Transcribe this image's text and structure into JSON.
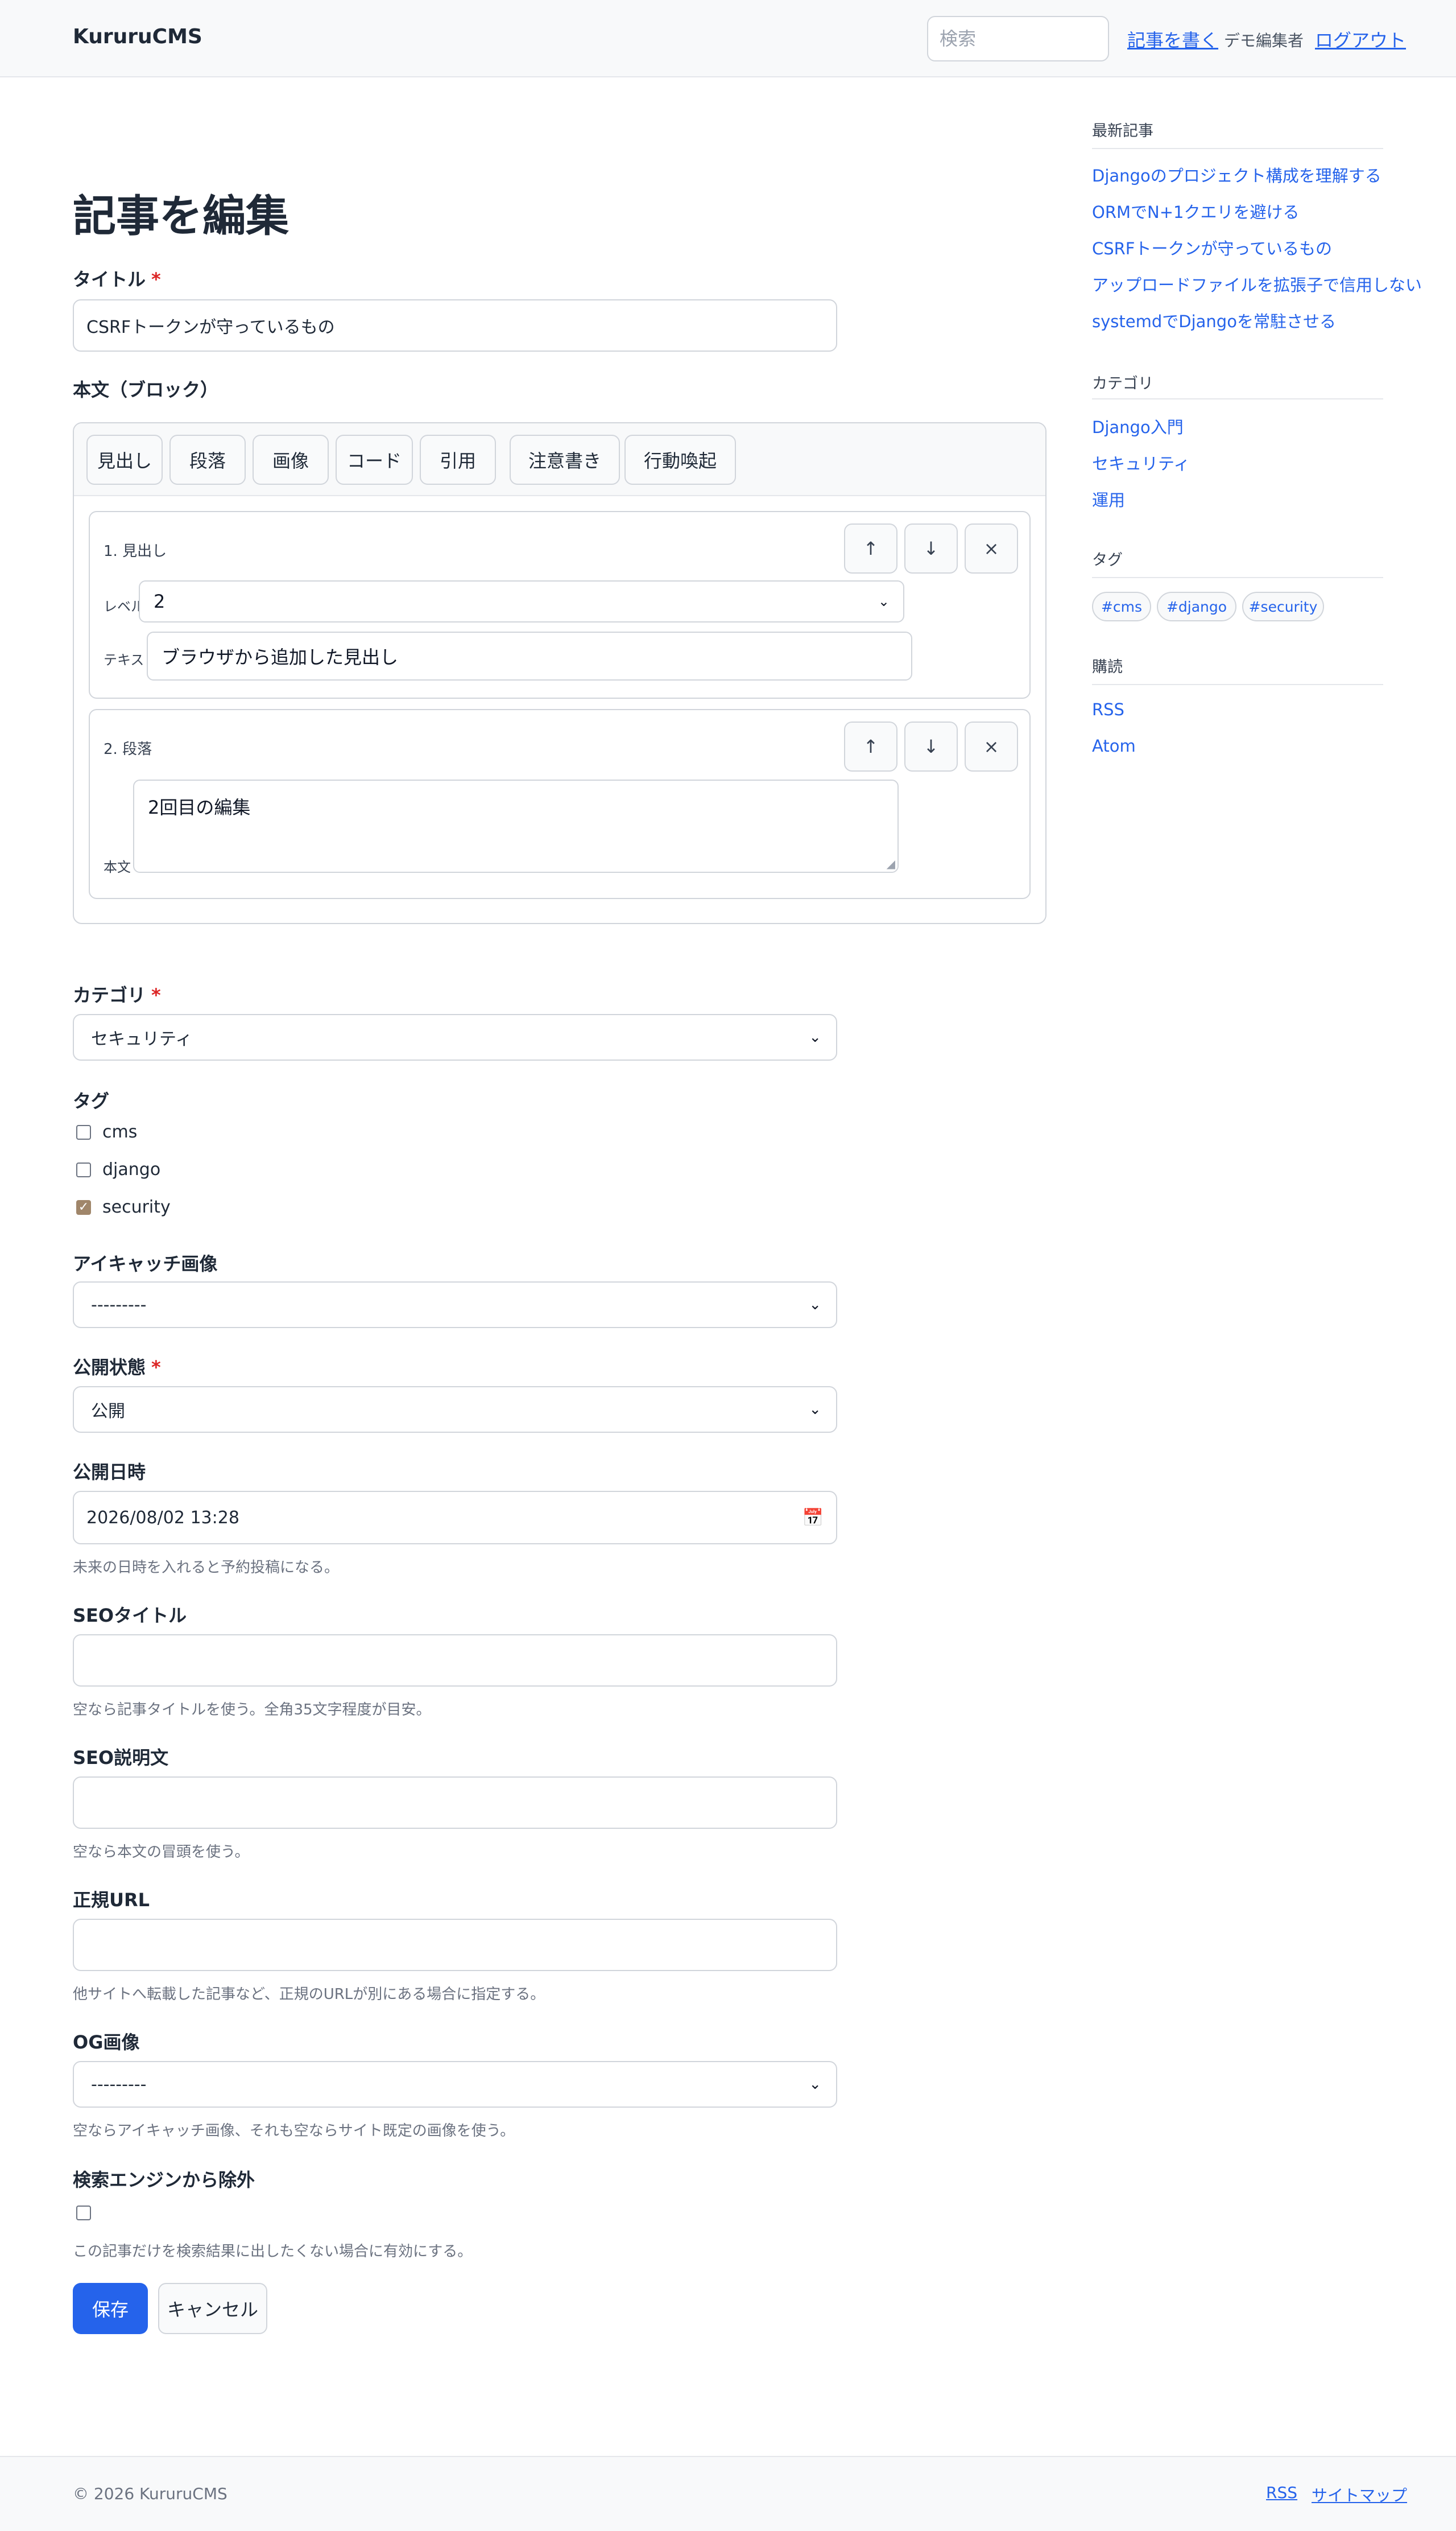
{
  "header": {
    "brand": "KururuCMS",
    "search_placeholder": "検索",
    "write_link": "記事を書く",
    "user": "デモ編集者",
    "logout_link": "ログアウト"
  },
  "main": {
    "title": "記事を編集",
    "required_mark": "*",
    "title_label": "タイトル",
    "title_value": "CSRFトークンが守っているもの",
    "body_label": "本文（ブロック）",
    "toolbar": [
      "見出し",
      "段落",
      "画像",
      "コード",
      "引用",
      "注意書き",
      "行動喚起"
    ],
    "block_actions": {
      "up": "↑",
      "down": "↓",
      "remove": "×"
    },
    "blocks": [
      {
        "title": "1. 見出し",
        "level_label": "レベル",
        "level_value": "2",
        "text_label": "テキスト",
        "text_value": "ブラウザから追加した見出し"
      },
      {
        "title": "2. 段落",
        "body_label": "本文",
        "body_value": "2回目の編集"
      }
    ],
    "category_label": "カテゴリ",
    "category_value": "セキュリティ",
    "tags_label": "タグ",
    "tags": [
      {
        "label": "cms",
        "checked": false
      },
      {
        "label": "django",
        "checked": false
      },
      {
        "label": "security",
        "checked": true
      }
    ],
    "eyecatch_label": "アイキャッチ画像",
    "eyecatch_value": "---------",
    "status_label": "公開状態",
    "status_value": "公開",
    "published_label": "公開日時",
    "published_value": "2026/08/02  13:28",
    "published_help": "未来の日時を入れると予約投稿になる。",
    "seo_title_label": "SEOタイトル",
    "seo_title_help": "空なら記事タイトルを使う。全角35文字程度が目安。",
    "seo_desc_label": "SEO説明文",
    "seo_desc_help": "空なら本文の冒頭を使う。",
    "canonical_label": "正規URL",
    "canonical_help": "他サイトへ転載した記事など、正規のURLが別にある場合に指定する。",
    "og_label": "OG画像",
    "og_value": "---------",
    "og_help": "空ならアイキャッチ画像、それも空ならサイト既定の画像を使う。",
    "noindex_label": "検索エンジンから除外",
    "noindex_help": "この記事だけを検索結果に出したくない場合に有効にする。",
    "save": "保存",
    "cancel": "キャンセル"
  },
  "sidebar": {
    "recent_title": "最新記事",
    "recent": [
      "Djangoのプロジェクト構成を理解する",
      "ORMでN+1クエリを避ける",
      "CSRFトークンが守っているもの",
      "アップロードファイルを拡張子で信用しない",
      "systemdでDjangoを常駐させる"
    ],
    "categories_title": "カテゴリ",
    "categories": [
      "Django入門",
      "セキュリティ",
      "運用"
    ],
    "tags_title": "タグ",
    "tags": [
      "#cms",
      "#django",
      "#security"
    ],
    "subscribe_title": "購読",
    "subscribe": [
      "RSS",
      "Atom"
    ]
  },
  "footer": {
    "copyright": "© 2026 KururuCMS",
    "rss": "RSS",
    "sitemap": "サイトマップ"
  },
  "colors": {
    "accent": "#2563eb",
    "required": "#dc2626",
    "checkbox_checked": "#a0866a"
  }
}
